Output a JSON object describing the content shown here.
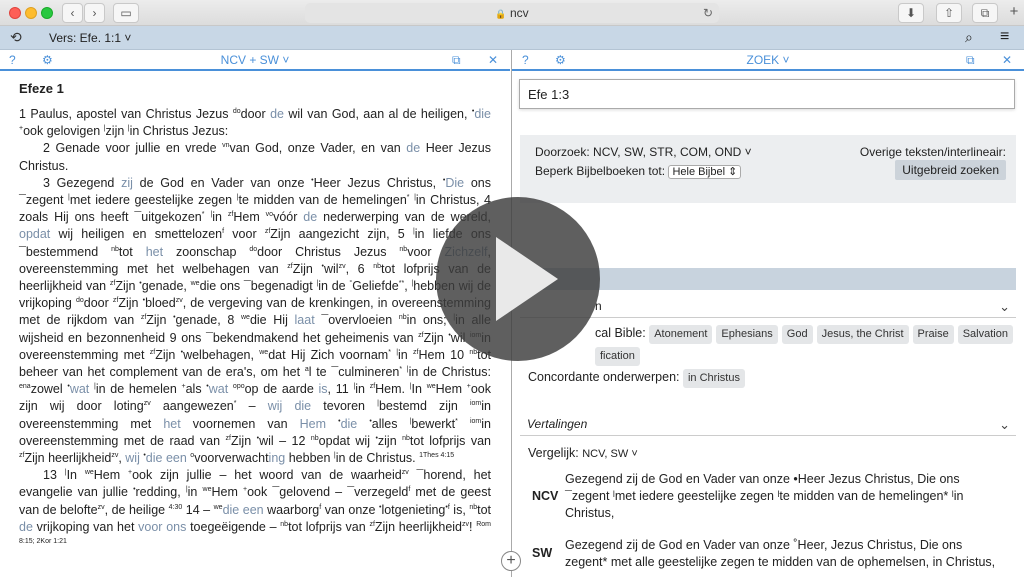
{
  "browser": {
    "url": "ncv",
    "lock": "🔒"
  },
  "toolbar": {
    "verse_label": "Vers: Efe. 1:1 ˅"
  },
  "left_pane": {
    "help": "?",
    "gear": "⚙",
    "title": "NCV + SW ˅",
    "chapter_title": "Efeze 1"
  },
  "right_pane": {
    "help": "?",
    "gear": "⚙",
    "title": "ZOEK ˅",
    "query": "Efe 1:3",
    "search_in_label": "Doorzoek:",
    "search_in_value": "NCV, SW, STR, COM, OND ˅",
    "limit_label": "Beperk Bijbelboeken tot:",
    "limit_value": "Hele Bijbel ⇕",
    "other_texts": "Overige teksten/interlineair:",
    "advanced_button": "Uitgebreid zoeken",
    "topics_header_partial": "n",
    "topics_label": "cal Bible:",
    "topics": [
      "Atonement",
      "Ephesians",
      "God",
      "Jesus, the Christ",
      "Praise",
      "Salvation"
    ],
    "topics_row2": [
      "fication"
    ],
    "concordance_label": "Concordante onderwerpen:",
    "concordance_tag": "in Christus",
    "translations_header": "Vertalingen",
    "compare_label": "Vergelijk:",
    "compare_value": "NCV, SW ˅",
    "ncv_label": "NCV",
    "sw_label": "SW",
    "ncv_text": "Gezegend zij de God en Vader van onze •Heer Jezus Christus, Die ons ¯zegent ˡmet iedere geestelijke zegen ˡte midden van de hemelingen* ˡin Christus,",
    "sw_text": "Gezegend zij de God en Vader van onze ˚Heer, Jezus Christus, Die ons zegent* met alle geestelijke zegen te midden van de ophemelsen, in Christus,"
  }
}
